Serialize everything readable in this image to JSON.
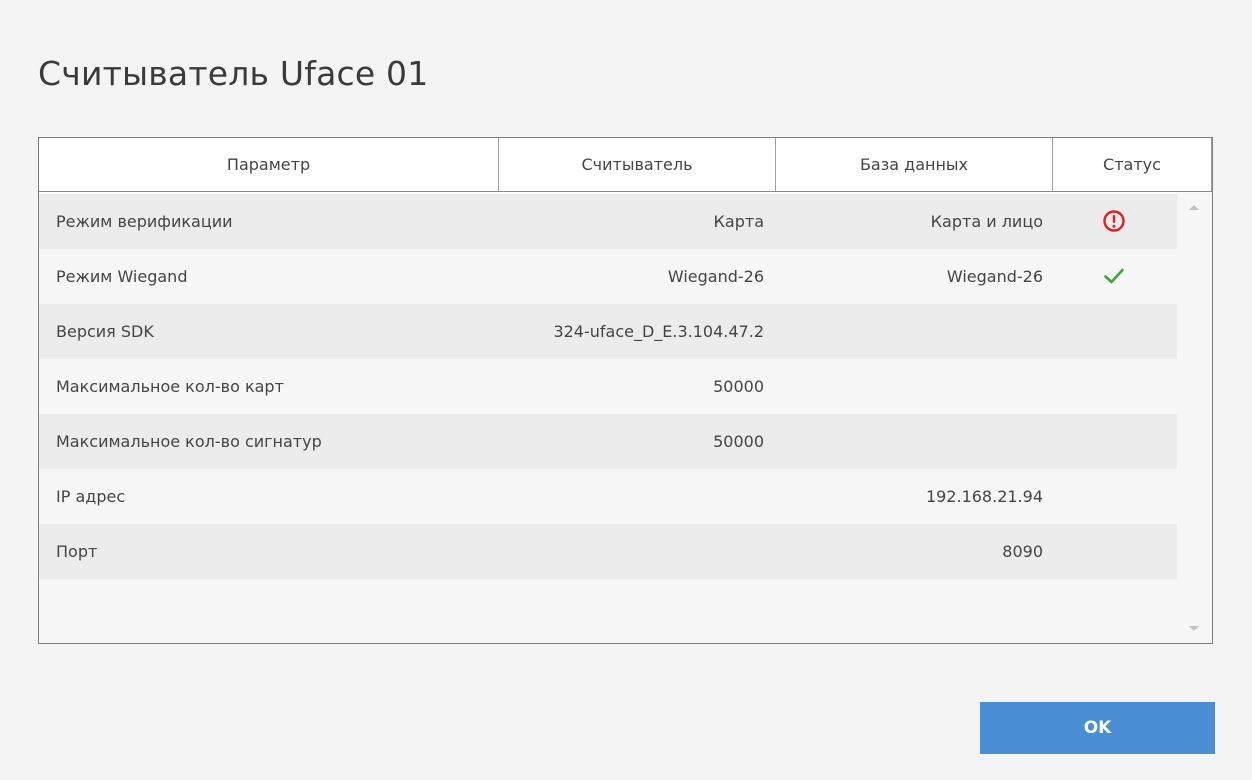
{
  "dialog": {
    "title": "Считыватель Uface 01",
    "ok_label": "OK"
  },
  "table": {
    "columns": [
      "Параметр",
      "Считыватель",
      "База данных",
      "Статус"
    ],
    "rows": [
      {
        "param": "Режим верификации",
        "reader": "Карта",
        "db": "Карта и лицо",
        "status": "error-icon"
      },
      {
        "param": "Режим Wiegand",
        "reader": "Wiegand-26",
        "db": "Wiegand-26",
        "status": "check-icon"
      },
      {
        "param": "Версия SDK",
        "reader": "324-uface_D_E.3.104.47.2",
        "db": "",
        "status": ""
      },
      {
        "param": "Максимальное кол-во карт",
        "reader": "50000",
        "db": "",
        "status": ""
      },
      {
        "param": "Максимальное кол-во сигнатур",
        "reader": "50000",
        "db": "",
        "status": ""
      },
      {
        "param": "IP адрес",
        "reader": "",
        "db": "192.168.21.94",
        "status": ""
      },
      {
        "param": "Порт",
        "reader": "",
        "db": "8090",
        "status": ""
      }
    ]
  },
  "colors": {
    "error": "#e02020",
    "success": "#3aa53a",
    "button": "#4a8fd4"
  }
}
